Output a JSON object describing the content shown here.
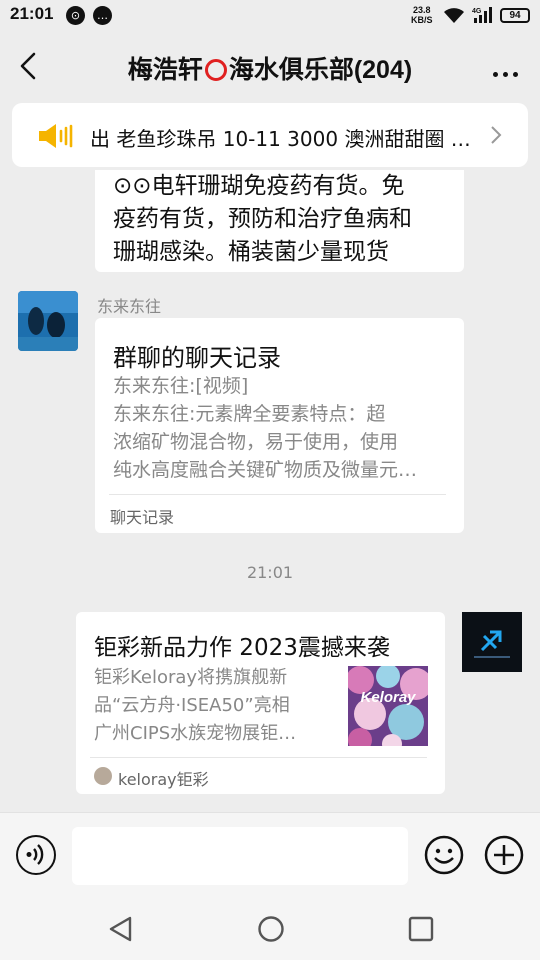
{
  "status_bar": {
    "time": "21:01",
    "speed_value": "23.8",
    "speed_unit": "KB/S",
    "network": "4G",
    "battery": "94"
  },
  "header": {
    "title_prefix": "梅浩轩",
    "title_suffix": "海水俱乐部(204)"
  },
  "announcement": {
    "text": "出 老鱼珍珠吊 10-11   3000 澳洲甜甜圈 …"
  },
  "messages": {
    "partial_text_line1": "⊙⊙电轩珊瑚免疫药有货。免",
    "partial_text_line2": "疫药有货，预防和治疗鱼病和",
    "partial_text_line3": "珊瑚感染。桶装菌少量现货",
    "sender_name": "东来东往",
    "record_card": {
      "title": "群聊的聊天记录",
      "line1": "东来东往:[视频]",
      "line2": "东来东往:元素牌全要素特点：超",
      "line3": "浓缩矿物混合物，易于使用，使用",
      "line4": "纯水高度融合关键矿物质及微量元…",
      "footer": "聊天记录"
    },
    "timestamp": "21:01",
    "link_card": {
      "title": "钜彩新品力作 2023震撼来袭",
      "desc1": "钜彩Keloray将携旗舰新",
      "desc2": "品“云方舟·ISEA50”亮相",
      "desc3": "广州CIPS水族宠物展钜…",
      "thumb_label": "Keloray",
      "source": "keloray钜彩"
    }
  },
  "input": {
    "placeholder": ""
  },
  "colors": {
    "background": "#ededed",
    "bubble": "#ffffff",
    "ring": "#e02020",
    "speaker": "#f5b400"
  }
}
